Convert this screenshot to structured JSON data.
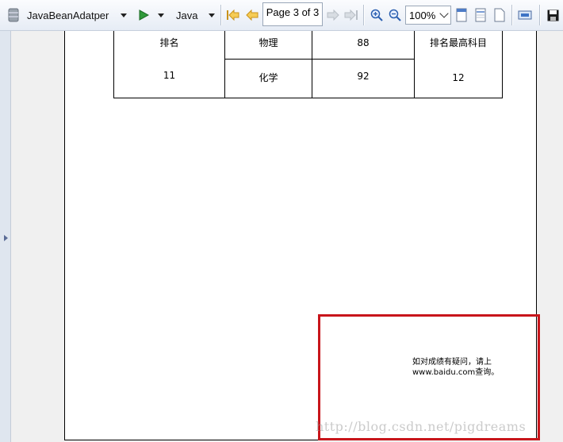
{
  "toolbar": {
    "datasource": "JavaBeanAdatper",
    "language": "Java",
    "page_indicator": "Page 3 of 3",
    "zoom": "100%"
  },
  "report": {
    "rows": [
      {
        "label": "排名",
        "subject": "物理",
        "score": "88",
        "extra_label": "排名最高科目"
      },
      {
        "label": "11",
        "subject": "化学",
        "score": "92",
        "extra_label": "12"
      }
    ],
    "note_line1": "如对成绩有疑问，请上",
    "note_line2": "www.baidu.com查询。"
  },
  "watermark": "http://blog.csdn.net/pigdreams",
  "colors": {
    "highlight": "#c8151b",
    "toolbar_bg": "#e6ecf5"
  }
}
